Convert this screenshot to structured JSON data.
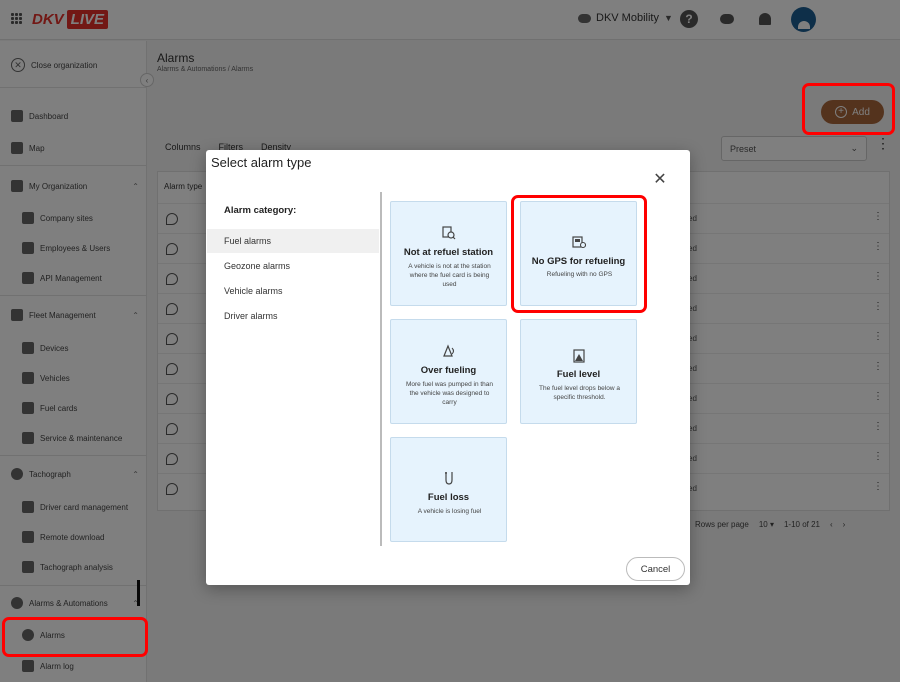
{
  "topbar": {
    "logo_dkv": "DKV",
    "logo_live": "LIVE",
    "org_name": "DKV Mobility",
    "help_glyph": "?"
  },
  "sidebar": {
    "close_org": "Close organization",
    "items": [
      {
        "label": "Dashboard",
        "icon": "dashboard-icon"
      },
      {
        "label": "Map",
        "icon": "map-icon"
      },
      {
        "label": "My Organization",
        "icon": "organization-icon"
      },
      {
        "label": "Company sites",
        "icon": "building-icon"
      },
      {
        "label": "Employees & Users",
        "icon": "users-icon"
      },
      {
        "label": "API Management",
        "icon": "key-icon"
      },
      {
        "label": "Fleet Management",
        "icon": "truck-icon"
      },
      {
        "label": "Devices",
        "icon": "device-icon"
      },
      {
        "label": "Vehicles",
        "icon": "vehicle-icon"
      },
      {
        "label": "Fuel cards",
        "icon": "card-icon"
      },
      {
        "label": "Service & maintenance",
        "icon": "wrench-icon"
      },
      {
        "label": "Tachograph",
        "icon": "tachograph-icon"
      },
      {
        "label": "Driver card management",
        "icon": "driver-card-icon"
      },
      {
        "label": "Remote download",
        "icon": "download-icon"
      },
      {
        "label": "Tachograph analysis",
        "icon": "analysis-icon"
      },
      {
        "label": "Alarms & Automations",
        "icon": "bell-icon"
      },
      {
        "label": "Alarms",
        "icon": "bell-icon"
      },
      {
        "label": "Alarm log",
        "icon": "log-icon"
      }
    ]
  },
  "main": {
    "title": "Alarms",
    "breadcrumb": "Alarms & Automations  /  Alarms",
    "add_label": "Add",
    "toolbar": {
      "columns": "Columns",
      "filters": "Filters",
      "density": "Density"
    },
    "preset_label": "Preset",
    "table_header": "Alarm type",
    "row_end_text": "ed",
    "pager": {
      "rows_label": "Rows per page",
      "rows_value": "10",
      "range": "1-10 of 21"
    }
  },
  "modal": {
    "title": "Select alarm type",
    "category_heading": "Alarm category:",
    "categories": [
      "Fuel alarms",
      "Geozone alarms",
      "Vehicle alarms",
      "Driver alarms"
    ],
    "cards": [
      {
        "title": "Not at refuel station",
        "desc": "A vehicle is not at the station where the fuel card is being used",
        "icon": "fuel-station-search-icon"
      },
      {
        "title": "No GPS for refueling",
        "desc": "Refueling with no GPS",
        "icon": "gps-off-fuel-icon"
      },
      {
        "title": "Over fueling",
        "desc": "More fuel was pumped in than the vehicle was designed to carry",
        "icon": "over-fueling-icon"
      },
      {
        "title": "Fuel level",
        "desc": "The fuel level drops below a specific threshold.",
        "icon": "fuel-level-icon"
      },
      {
        "title": "Fuel loss",
        "desc": "A vehicle is losing fuel",
        "icon": "fuel-loss-icon"
      }
    ],
    "cancel_label": "Cancel"
  },
  "colors": {
    "brand_red": "#e4312b",
    "card_bg": "#e6f3fd",
    "add_button": "#a8663a",
    "highlight": "#ff0000"
  }
}
